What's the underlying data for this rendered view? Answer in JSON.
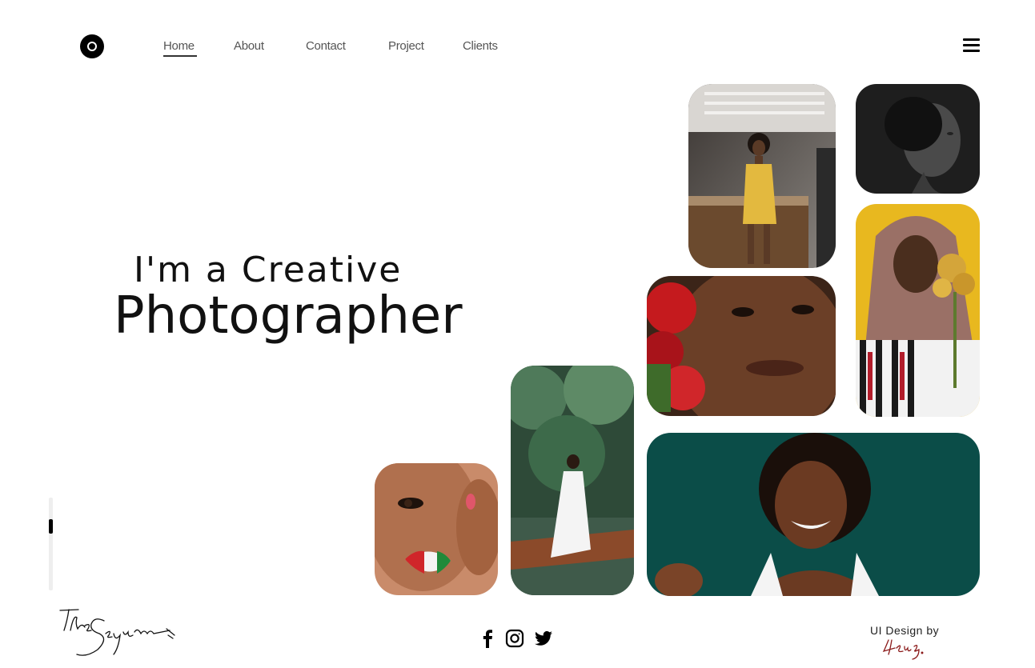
{
  "nav": {
    "items": [
      {
        "label": "Home",
        "active": true
      },
      {
        "label": "About",
        "active": false
      },
      {
        "label": "Contact",
        "active": false
      },
      {
        "label": "Project",
        "active": false
      },
      {
        "label": "Clients",
        "active": false
      }
    ]
  },
  "hero": {
    "line1": "I'm a Creative",
    "line2": "Photographer"
  },
  "gallery": [
    {
      "name": "woman-yellow-dress-cafe-photo"
    },
    {
      "name": "woman-profile-bw-photo"
    },
    {
      "name": "woman-headscarf-flowers-photo"
    },
    {
      "name": "face-red-roses-photo"
    },
    {
      "name": "woman-white-dress-boat-photo"
    },
    {
      "name": "face-painted-lips-photo"
    },
    {
      "name": "woman-smiling-teal-photo"
    }
  ],
  "socials": [
    "facebook-icon",
    "instagram-icon",
    "twitter-icon"
  ],
  "credit": {
    "label": "UI Design by"
  },
  "colors": {
    "text": "#111111",
    "nav_text": "#555555",
    "accent_black": "#000000",
    "credit_signature": "#8b1a1a"
  }
}
